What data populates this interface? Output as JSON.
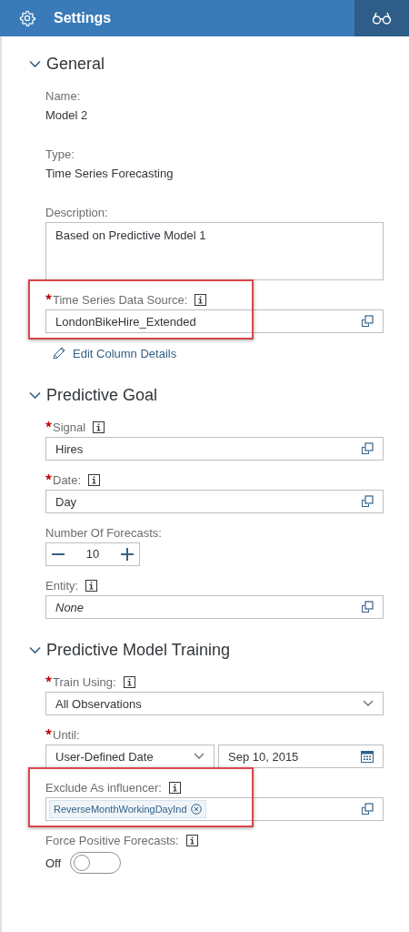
{
  "header": {
    "title": "Settings"
  },
  "sections": [
    {
      "title": "General",
      "expanded": true,
      "fields": [
        {
          "kind": "text",
          "label": "Name:",
          "value": "Model 2"
        },
        {
          "kind": "text",
          "label": "Type:",
          "value": "Time Series Forecasting"
        },
        {
          "kind": "textarea",
          "label": "Description:",
          "value": "Based on Predictive Model 1"
        },
        {
          "kind": "value_help",
          "label": "Time Series Data Source:",
          "required": true,
          "info": true,
          "highlighted": true,
          "value": "LondonBikeHire_Extended"
        },
        {
          "kind": "link",
          "value": "Edit Column Details"
        }
      ]
    },
    {
      "title": "Predictive Goal",
      "expanded": true,
      "fields": [
        {
          "kind": "value_help",
          "label": "Signal",
          "required": true,
          "info": true,
          "highlighted": false,
          "value": "Hires"
        },
        {
          "kind": "value_help",
          "label": "Date:",
          "required": true,
          "info": true,
          "highlighted": false,
          "value": "Day"
        },
        {
          "kind": "stepper",
          "label": "Number Of Forecasts:",
          "value": "10"
        },
        {
          "kind": "value_help",
          "label": "Entity:",
          "required": false,
          "info": true,
          "highlighted": false,
          "placeholder": "None"
        }
      ]
    },
    {
      "title": "Predictive Model Training",
      "expanded": true,
      "fields": [
        {
          "kind": "select",
          "label": "Train Using:",
          "required": true,
          "info": true,
          "value": "All Observations"
        },
        {
          "kind": "date_pair",
          "label": "Until:",
          "required": true,
          "value": "User-Defined Date",
          "date": "Sep 10, 2015"
        },
        {
          "kind": "tokens",
          "label": "Exclude As influencer:",
          "info": true,
          "highlighted": true,
          "tokens": [
            "ReverseMonthWorkingDayInd"
          ]
        },
        {
          "kind": "switch",
          "label": "Force Positive Forecasts:",
          "info": true,
          "on": false,
          "state_text": "Off"
        }
      ]
    }
  ]
}
